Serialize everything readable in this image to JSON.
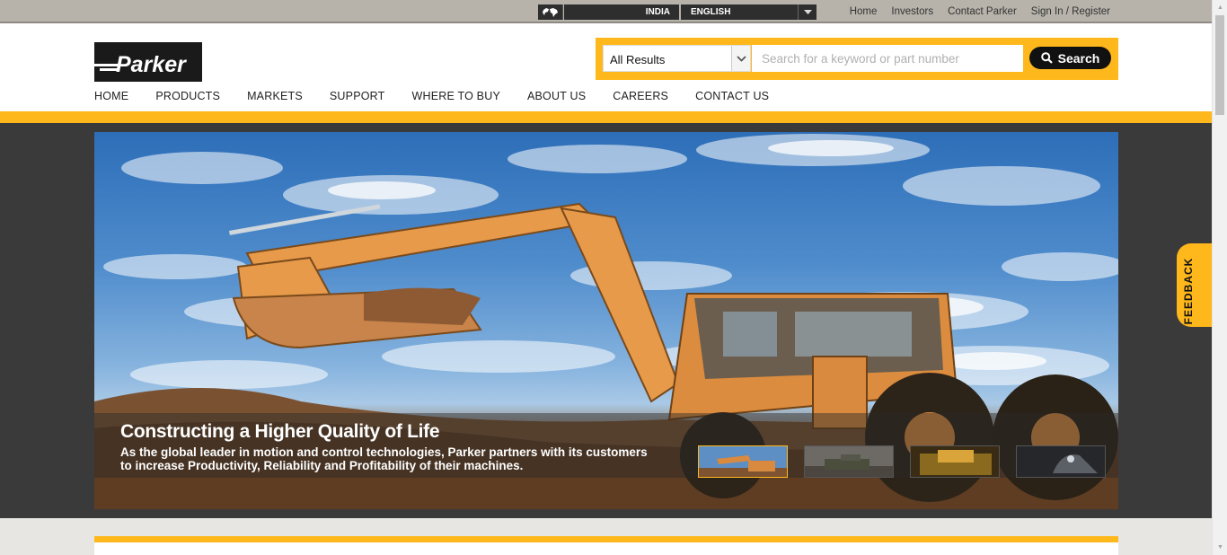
{
  "utility": {
    "country": "INDIA",
    "language": "ENGLISH",
    "links": [
      "Home",
      "Investors",
      "Contact Parker",
      "Sign In / Register"
    ]
  },
  "logo": {
    "text": "Parker"
  },
  "search": {
    "scope": "All Results",
    "placeholder": "Search for a keyword or part number",
    "button": "Search"
  },
  "nav": [
    "HOME",
    "PRODUCTS",
    "MARKETS",
    "SUPPORT",
    "WHERE TO BUY",
    "ABOUT US",
    "CAREERS",
    "CONTACT US"
  ],
  "hero": {
    "title": "Constructing a Higher Quality of Life",
    "description_line1": "As the global leader in motion and control technologies, Parker partners with its customers",
    "description_line2": "to increase Productivity, Reliability and Profitability of their machines.",
    "thumbnails": [
      "backhoe-loader",
      "military-tank",
      "mining-site",
      "rail-tunnel"
    ]
  },
  "feedback": "FEEDBACK",
  "colors": {
    "brand_yellow": "#ffb81c",
    "dark": "#111111"
  }
}
